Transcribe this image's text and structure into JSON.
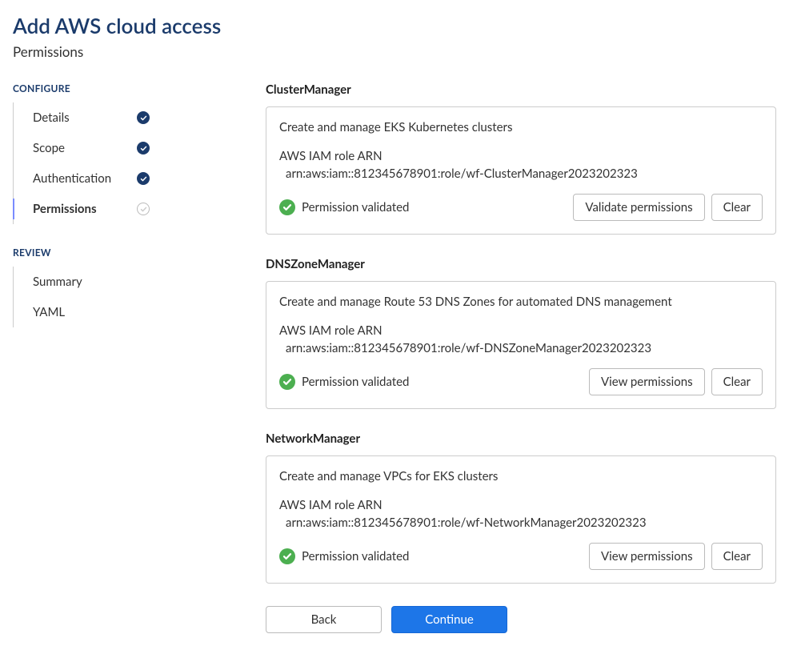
{
  "header": {
    "title": "Add AWS cloud access",
    "subtitle": "Permissions"
  },
  "sidebar": {
    "sections": [
      {
        "label": "CONFIGURE",
        "items": [
          {
            "label": "Details",
            "status": "done"
          },
          {
            "label": "Scope",
            "status": "done"
          },
          {
            "label": "Authentication",
            "status": "done"
          },
          {
            "label": "Permissions",
            "status": "current"
          }
        ]
      },
      {
        "label": "REVIEW",
        "items": [
          {
            "label": "Summary",
            "status": "pending"
          },
          {
            "label": "YAML",
            "status": "pending"
          }
        ]
      }
    ]
  },
  "permissions": [
    {
      "name": "ClusterManager",
      "description": "Create and manage EKS Kubernetes clusters",
      "arn_label": "AWS IAM role ARN",
      "arn_value": "arn:aws:iam::812345678901:role/wf-ClusterManager2023202323",
      "validated_text": "Permission validated",
      "action_button": "Validate permissions",
      "clear_button": "Clear"
    },
    {
      "name": "DNSZoneManager",
      "description": "Create and manage Route 53 DNS Zones for automated DNS management",
      "arn_label": "AWS IAM role ARN",
      "arn_value": "arn:aws:iam::812345678901:role/wf-DNSZoneManager2023202323",
      "validated_text": "Permission validated",
      "action_button": "View permissions",
      "clear_button": "Clear"
    },
    {
      "name": "NetworkManager",
      "description": "Create and manage VPCs for EKS clusters",
      "arn_label": "AWS IAM role ARN",
      "arn_value": "arn:aws:iam::812345678901:role/wf-NetworkManager2023202323",
      "validated_text": "Permission validated",
      "action_button": "View permissions",
      "clear_button": "Clear"
    }
  ],
  "footer": {
    "back": "Back",
    "continue": "Continue"
  }
}
